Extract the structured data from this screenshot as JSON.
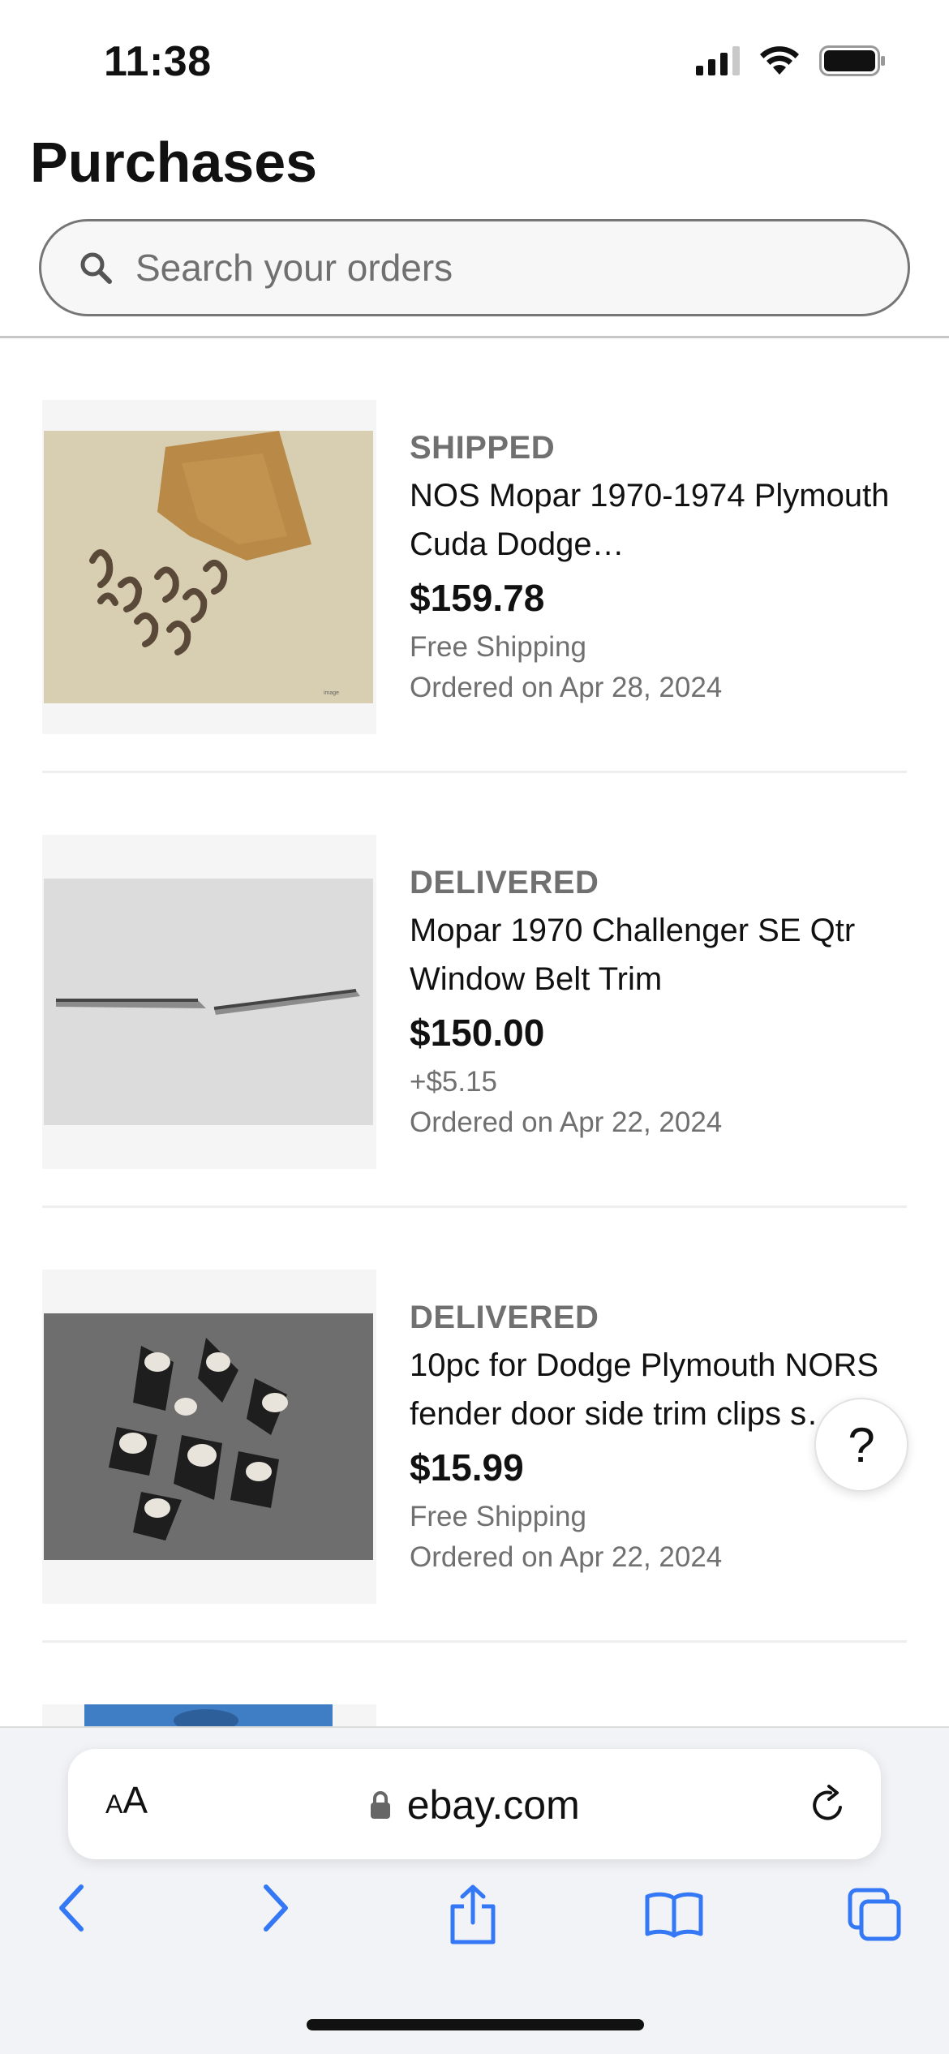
{
  "status_bar": {
    "time": "11:38"
  },
  "header": {
    "title": "Purchases",
    "search_placeholder": "Search your orders"
  },
  "orders": [
    {
      "status": "SHIPPED",
      "title": "NOS Mopar 1970-1974 Plymouth Cuda Dodge…",
      "price": "$159.78",
      "shipping": "Free Shipping",
      "date": "Ordered on Apr 28, 2024"
    },
    {
      "status": "DELIVERED",
      "title": "Mopar 1970 Challenger SE Qtr Window Belt Trim",
      "price": "$150.00",
      "shipping": "+$5.15",
      "date": "Ordered on Apr 22, 2024"
    },
    {
      "status": "DELIVERED",
      "title": "10pc for Dodge Plymouth NORS fender door side trim clips s…",
      "price": "$15.99",
      "shipping": "Free Shipping",
      "date": "Ordered on Apr 22, 2024"
    }
  ],
  "help_button": {
    "label": "?"
  },
  "browser": {
    "text_size_label": "AA",
    "domain": "ebay.com"
  },
  "colors": {
    "text_primary": "#111111",
    "text_secondary": "#707070",
    "browser_blue": "#3478f6"
  },
  "icons": {
    "search": "search-icon",
    "lock": "lock-icon",
    "reload": "reload-icon",
    "back": "back-arrow-icon",
    "forward": "forward-arrow-icon",
    "share": "share-icon",
    "bookmarks": "bookmarks-icon",
    "tabs": "tabs-icon"
  }
}
